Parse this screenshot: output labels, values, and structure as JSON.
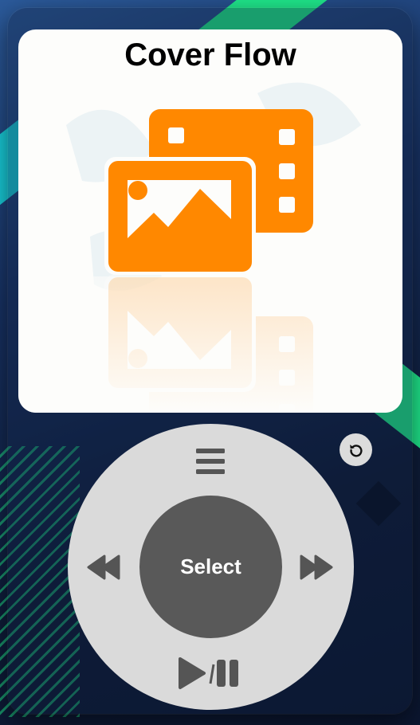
{
  "screen": {
    "title": "Cover Flow",
    "icon": "photos-and-videos-icon",
    "accent_color": "#ff8800"
  },
  "controls": {
    "select_label": "Select",
    "menu_icon": "menu-icon",
    "previous_icon": "rewind-icon",
    "next_icon": "fast-forward-icon",
    "play_pause_icon": "play-pause-icon",
    "reset_icon": "reset-icon",
    "wheel_color": "#dadada",
    "center_color": "#595959"
  }
}
